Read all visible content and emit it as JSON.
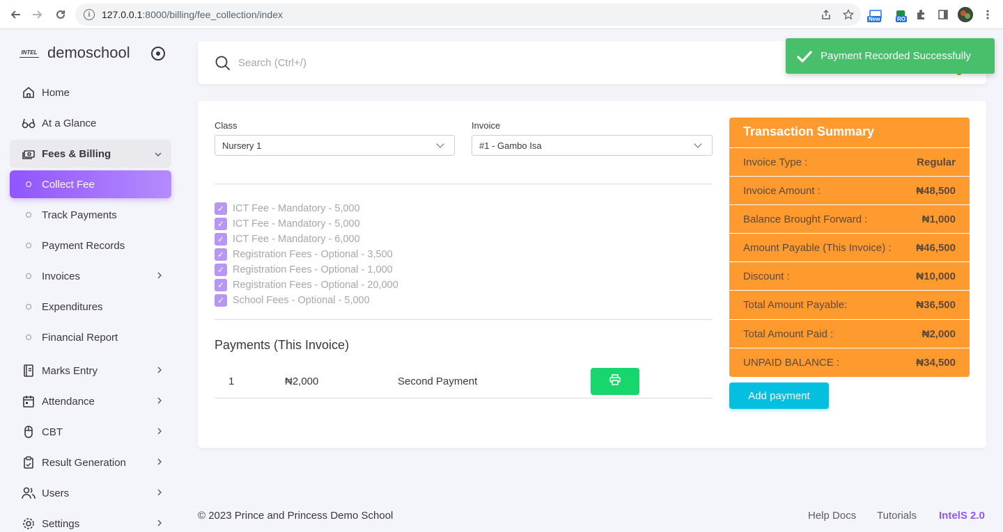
{
  "browser": {
    "url_host": "127.0.0.1",
    "url_rest": ":8000/billing/fee_collection/index",
    "ext_badges": [
      "New",
      "RO"
    ]
  },
  "sidebar": {
    "brand_logo": "INTEL",
    "brand_name": "demoschool",
    "items": [
      {
        "label": "Home",
        "icon": "home-icon"
      },
      {
        "label": "At a Glance",
        "icon": "glasses-icon"
      },
      {
        "label": "Fees & Billing",
        "icon": "cash-icon"
      },
      {
        "label": "Collect Fee"
      },
      {
        "label": "Track Payments"
      },
      {
        "label": "Payment Records"
      },
      {
        "label": "Invoices"
      },
      {
        "label": "Expenditures"
      },
      {
        "label": "Financial Report"
      },
      {
        "label": "Marks Entry",
        "icon": "notebook-icon"
      },
      {
        "label": "Attendance",
        "icon": "calendar-icon"
      },
      {
        "label": "CBT",
        "icon": "mouse-icon"
      },
      {
        "label": "Result Generation",
        "icon": "clipboard-icon"
      },
      {
        "label": "Users",
        "icon": "users-icon"
      },
      {
        "label": "Settings",
        "icon": "settings-icon"
      }
    ]
  },
  "search": {
    "placeholder": "Search (Ctrl+/)"
  },
  "form": {
    "class_label": "Class",
    "class_value": "Nursery 1",
    "invoice_label": "Invoice",
    "invoice_value": "#1 - Gambo Isa"
  },
  "fees": [
    "ICT Fee - Mandatory - 5,000",
    "ICT Fee - Mandatory - 5,000",
    "ICT Fee - Mandatory - 6,000",
    "Registration Fees - Optional - 3,500",
    "Registration Fees - Optional - 1,000",
    "Registration Fees - Optional - 20,000",
    "School Fees - Optional - 5,000"
  ],
  "payments": {
    "title": "Payments (This Invoice)",
    "rows": [
      {
        "index": "1",
        "amount": "₦2,000",
        "description": "Second Payment"
      }
    ]
  },
  "summary": {
    "title": "Transaction Summary",
    "rows": [
      {
        "label": "Invoice Type :",
        "value": "Regular"
      },
      {
        "label": "Invoice Amount :",
        "value": "₦48,500"
      },
      {
        "label": "Balance Brought Forward :",
        "value": "₦1,000"
      },
      {
        "label": "Amount Payable (This Invoice) :",
        "value": "₦46,500"
      },
      {
        "label": "Discount :",
        "value": "₦10,000"
      },
      {
        "label": "Total Amount Payable:",
        "value": "₦36,500"
      },
      {
        "label": "Total Amount Paid :",
        "value": "₦2,000"
      },
      {
        "label": "UNPAID BALANCE :",
        "value": "₦34,500"
      }
    ],
    "add_payment_label": "Add payment"
  },
  "footer": {
    "copyright": "© 2023 Prince and Princess Demo School",
    "help_docs": "Help Docs",
    "tutorials": "Tutorials",
    "brand": "IntelS 2.0"
  },
  "toast": {
    "message": "Payment Recorded Successfully"
  },
  "colors": {
    "accent": "#9155fd",
    "summary_bg": "#ff9a2e",
    "add_button": "#04bfe0",
    "print_button": "#17d66b",
    "toast_bg": "#48c06b"
  }
}
